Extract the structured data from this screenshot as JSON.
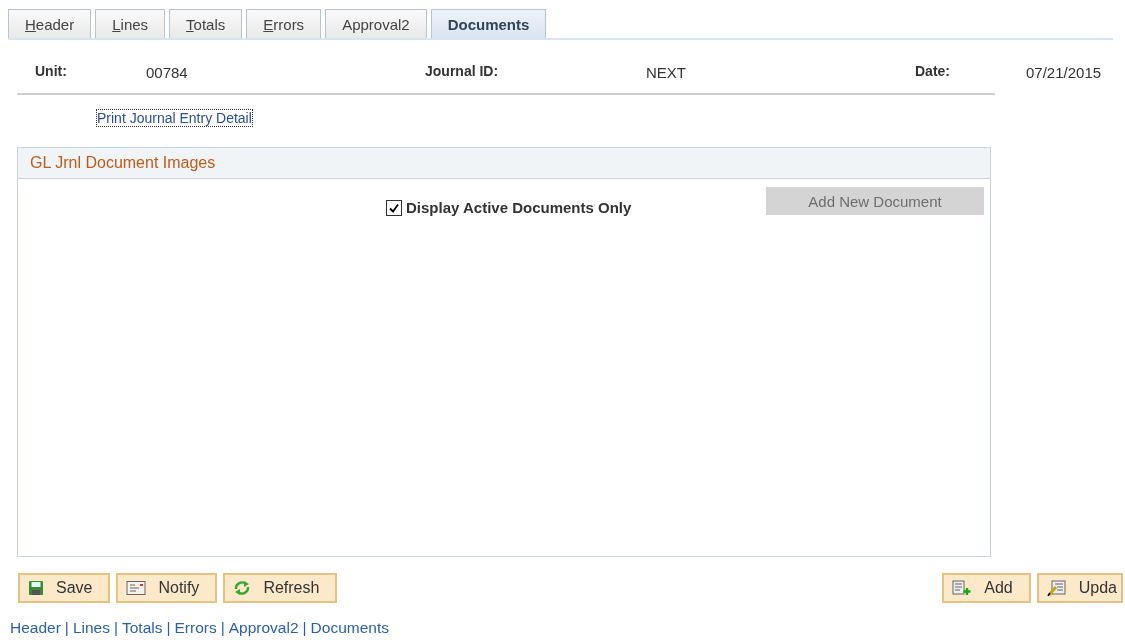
{
  "tabs": [
    {
      "label": "Header",
      "underline_first": true,
      "selected": false
    },
    {
      "label": "Lines",
      "underline_first": true,
      "selected": false
    },
    {
      "label": "Totals",
      "underline_first": true,
      "selected": false
    },
    {
      "label": "Errors",
      "underline_first": true,
      "selected": false
    },
    {
      "label": "Approval2",
      "underline_first": false,
      "selected": false
    },
    {
      "label": "Documents",
      "underline_first": false,
      "selected": true
    }
  ],
  "header_fields": [
    {
      "label": "Unit:",
      "value": "00784"
    },
    {
      "label": "Journal ID:",
      "value": "NEXT"
    },
    {
      "label": "Date:",
      "value": "07/21/2015"
    }
  ],
  "print_link": "Print Journal Entry Detail",
  "panel": {
    "title": "GL Jrnl Document Images",
    "checkbox": {
      "label": "Display Active Documents Only",
      "checked": true
    },
    "add_button": {
      "label": "Add New Document",
      "disabled": true
    }
  },
  "left_buttons": [
    {
      "kind": "save",
      "label": "Save"
    },
    {
      "kind": "notify",
      "label": "Notify"
    },
    {
      "kind": "refresh",
      "label": "Refresh"
    }
  ],
  "right_buttons": [
    {
      "kind": "add",
      "label": "Add"
    },
    {
      "kind": "update",
      "label": "Upda"
    }
  ],
  "footer": {
    "separator": "|",
    "links": [
      "Header",
      "Lines",
      "Totals",
      "Errors",
      "Approval2",
      "Documents"
    ]
  }
}
